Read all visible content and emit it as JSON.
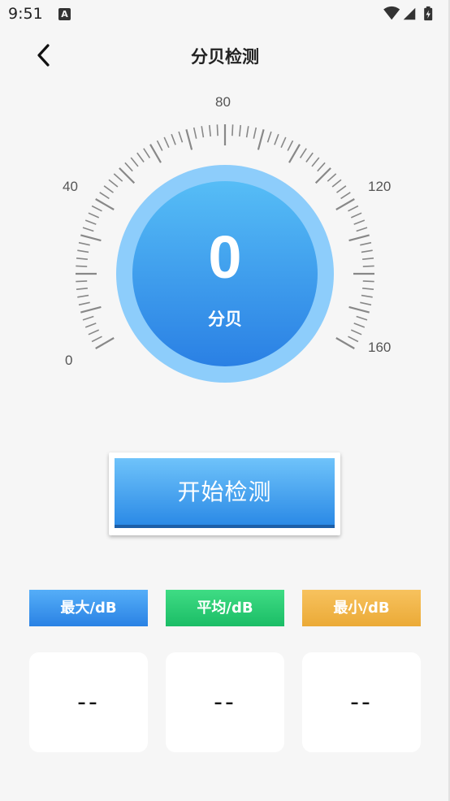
{
  "status_bar": {
    "time": "9:51",
    "app_icon_letter": "A",
    "icons": [
      "wifi-icon",
      "signal-icon",
      "battery-charging-icon"
    ]
  },
  "header": {
    "title": "分贝检测",
    "back_icon": "chevron-left-icon"
  },
  "gauge": {
    "value": "0",
    "unit_label": "分贝",
    "scale_labels": [
      "0",
      "40",
      "80",
      "120",
      "160"
    ],
    "colors": {
      "outer_ring": "#8dcdfb",
      "inner_top": "#56bdf6",
      "inner_bottom": "#2a80e4",
      "tick": "#888888"
    }
  },
  "start_button": {
    "label": "开始检测"
  },
  "stats": [
    {
      "label": "最大/dB",
      "value": "--",
      "color": "#3c96ee"
    },
    {
      "label": "平均/dB",
      "value": "--",
      "color": "#2dcc75"
    },
    {
      "label": "最小/dB",
      "value": "--",
      "color": "#f1b648"
    }
  ]
}
